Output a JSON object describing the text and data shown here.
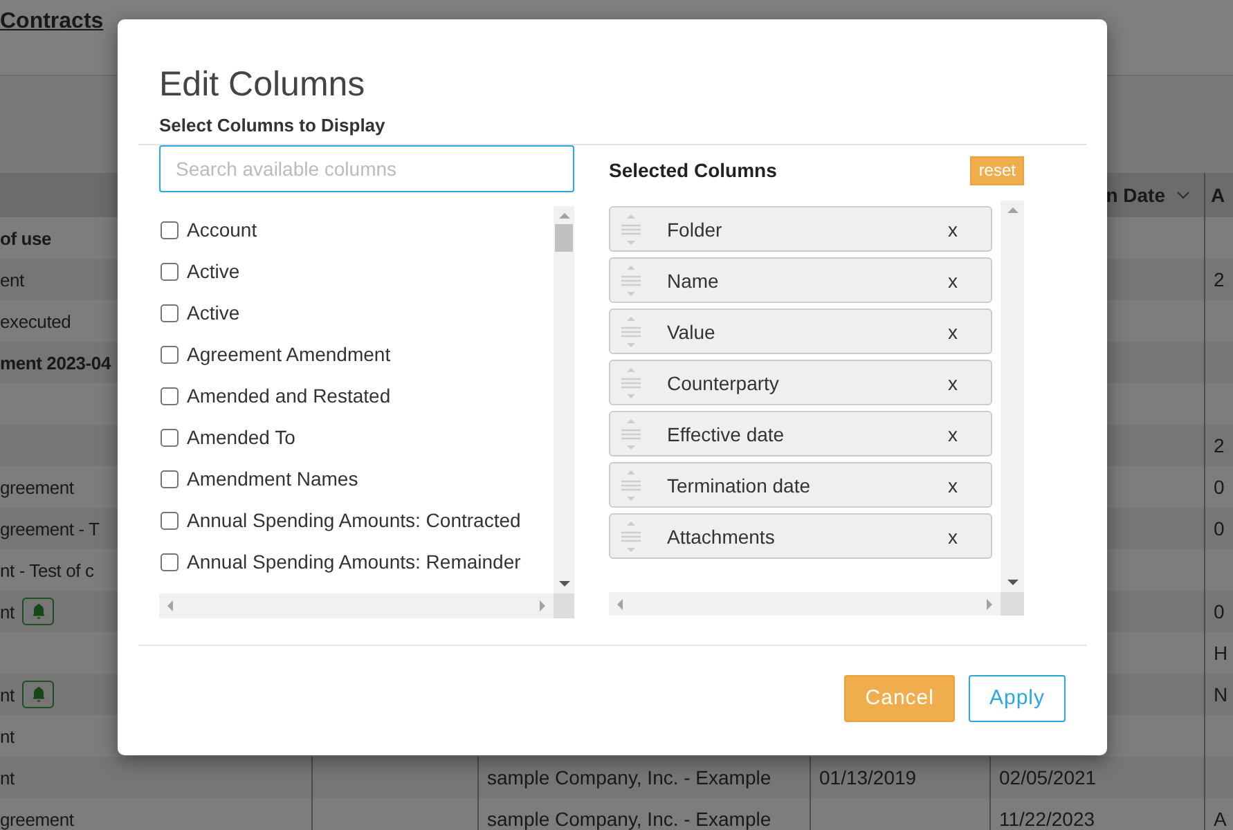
{
  "header": {
    "link": "Contracts"
  },
  "table": {
    "headers": [
      {
        "label": "n Date",
        "sortable": true
      },
      {
        "label": "A"
      }
    ],
    "rows": [
      {
        "column_1": "of use",
        "bold": true
      },
      {
        "column_1": "ent",
        "column_6": "2",
        "bold": false
      },
      {
        "column_1": "executed",
        "bold": false
      },
      {
        "column_1": "ment 2023-04",
        "bold": true
      },
      {},
      {
        "column_6": "2"
      },
      {
        "column_1": "greement",
        "column_6": "0",
        "bold": false
      },
      {
        "column_1": "greement - T",
        "column_6": "0",
        "bold": false
      },
      {
        "column_1": "nt - Test of c",
        "bold": false
      },
      {
        "column_1": "nt",
        "column_6": "0",
        "bold": false,
        "alert": true
      },
      {
        "column_6": "H"
      },
      {
        "column_1": "nt",
        "column_6": "N",
        "bold": false,
        "alert": true
      },
      {
        "column_1": "nt",
        "bold": false
      },
      {
        "column_1": "nt",
        "column_3": "sample Company, Inc. - Example",
        "column_4": "01/13/2019",
        "column_5": "02/05/2021",
        "bold": false
      },
      {
        "column_1": "greement",
        "column_3": "sample Company, Inc. - Example",
        "column_5": "11/22/2023",
        "column_6": "A",
        "bold": false
      }
    ]
  },
  "dialog": {
    "title": "Edit Columns",
    "subtitle": "Select Columns to Display",
    "search": {
      "placeholder": "Search available columns"
    },
    "available": [
      {
        "label": "Account",
        "checked": false
      },
      {
        "label": "Active",
        "checked": false
      },
      {
        "label": "Active",
        "checked": false
      },
      {
        "label": "Agreement Amendment",
        "checked": false
      },
      {
        "label": "Amended and Restated",
        "checked": false
      },
      {
        "label": "Amended To",
        "checked": false
      },
      {
        "label": "Amendment Names",
        "checked": false
      },
      {
        "label": "Annual Spending Amounts: Contracted",
        "checked": false
      },
      {
        "label": "Annual Spending Amounts: Remainder",
        "checked": false
      }
    ],
    "selected_title": "Selected Columns",
    "reset": "reset",
    "selected": [
      {
        "label": "Folder",
        "remove": "x"
      },
      {
        "label": "Name",
        "remove": "x"
      },
      {
        "label": "Value",
        "remove": "x"
      },
      {
        "label": "Counterparty",
        "remove": "x"
      },
      {
        "label": "Effective date",
        "remove": "x"
      },
      {
        "label": "Termination date",
        "remove": "x"
      },
      {
        "label": "Attachments",
        "remove": "x"
      }
    ],
    "buttons": [
      {
        "label": "Cancel",
        "kind": "secondary"
      },
      {
        "label": "Apply",
        "kind": "primary"
      }
    ]
  }
}
